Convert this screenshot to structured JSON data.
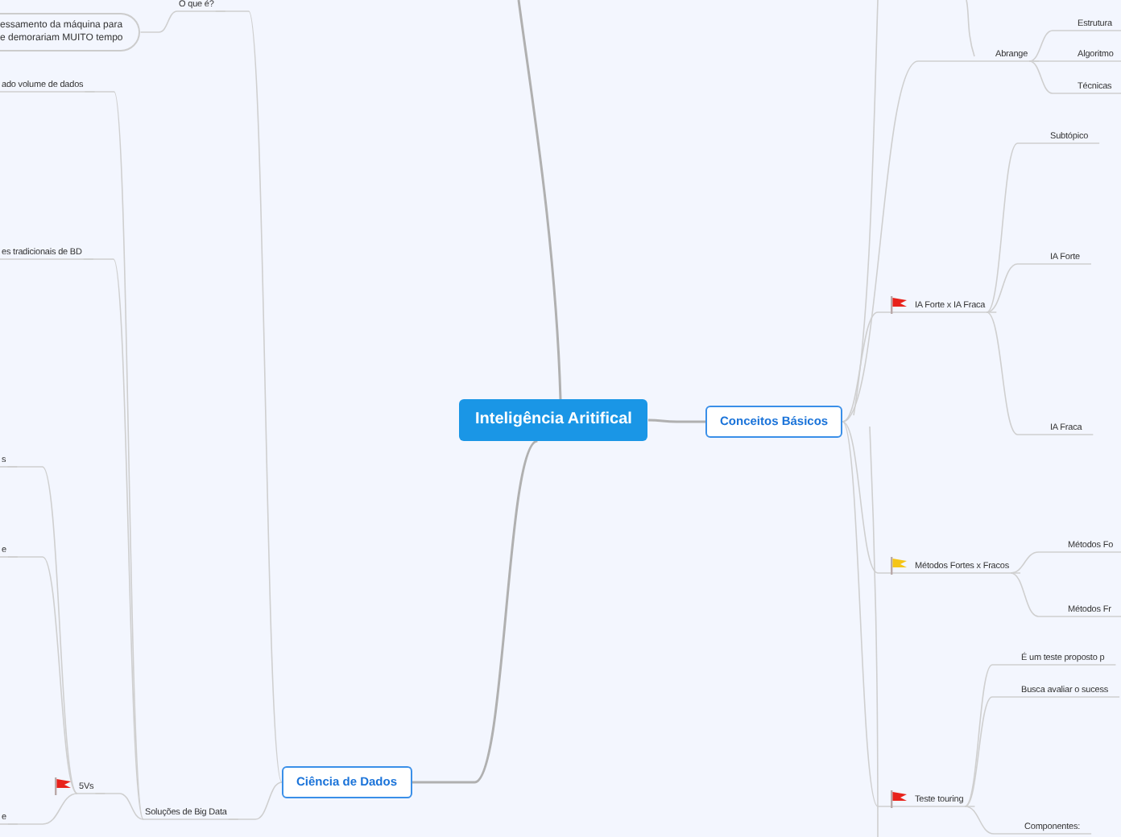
{
  "central_topic": {
    "label": "Inteligência Aritifical"
  },
  "branches": [
    {
      "label": "Conceitos Básicos",
      "children": [
        {
          "kind": "topic",
          "label": "Abrange",
          "children": [
            {
              "kind": "topic",
              "label": "Estrutura"
            },
            {
              "kind": "topic",
              "label": "Algoritmo"
            },
            {
              "kind": "topic",
              "label": "Técnicas"
            }
          ]
        },
        {
          "kind": "topic",
          "label": "IA Forte x IA Fraca",
          "color": "#e8221b",
          "children": [
            {
              "kind": "topic",
              "label": "Subtópico"
            },
            {
              "kind": "topic",
              "label": "IA Forte"
            },
            {
              "kind": "topic",
              "label": "IA Fraca"
            }
          ]
        },
        {
          "kind": "topic",
          "label": "Métodos Fortes x Fracos",
          "color": "#f5c518",
          "children": [
            {
              "kind": "topic",
              "label": "Métodos Fo"
            },
            {
              "kind": "topic",
              "label": "Métodos Fr"
            }
          ]
        },
        {
          "kind": "topic",
          "label": "Teste touring",
          "color": "#e8221b",
          "children": [
            {
              "kind": "topic",
              "label": "É um teste proposto p"
            },
            {
              "kind": "topic",
              "label": "Busca avaliar o sucess"
            },
            {
              "kind": "topic",
              "label": "Componentes:"
            }
          ]
        }
      ]
    },
    {
      "label": "Ciência de Dados",
      "children": [
        {
          "kind": "topic",
          "label": "O que é?",
          "children": [
            {
              "kind": "note",
              "label": "essamento da máquina para\ne demorariam MUITO tempo"
            }
          ]
        },
        {
          "kind": "topic",
          "label": "Soluções de Big Data",
          "children": [
            {
              "kind": "topic",
              "label": "ado volume de dados"
            },
            {
              "kind": "topic",
              "label": "es tradicionais de BD"
            },
            {
              "kind": "topic",
              "label": "5Vs",
              "color": "#e8221b",
              "children": [
                {
                  "kind": "topic",
                  "label": "s"
                },
                {
                  "kind": "topic",
                  "label": "e"
                },
                {
                  "kind": "topic",
                  "label": "e"
                }
              ]
            }
          ]
        }
      ]
    }
  ]
}
